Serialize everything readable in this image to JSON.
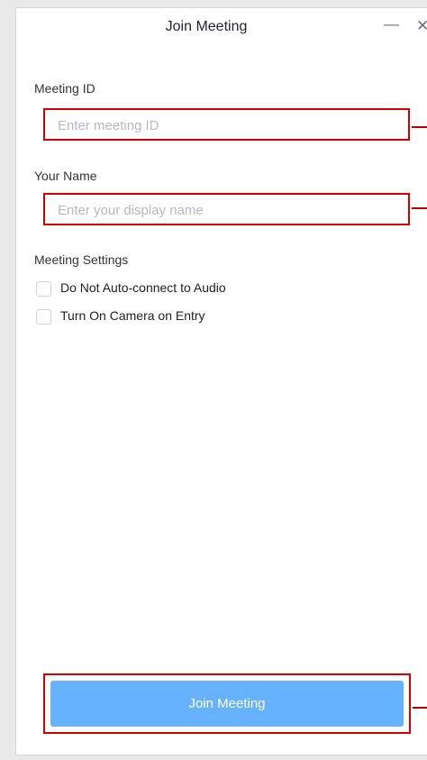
{
  "window": {
    "title": "Join Meeting",
    "minimize_glyph": "—",
    "close_glyph": "✕"
  },
  "meeting_id": {
    "label": "Meeting ID",
    "placeholder": "Enter meeting ID",
    "value": ""
  },
  "your_name": {
    "label": "Your Name",
    "placeholder": "Enter your display name",
    "value": ""
  },
  "settings": {
    "heading": "Meeting Settings",
    "options": [
      {
        "label": "Do Not Auto-connect to Audio",
        "checked": false
      },
      {
        "label": "Turn On Camera on Entry",
        "checked": false
      }
    ]
  },
  "join_button": {
    "label": "Join Meeting"
  },
  "colors": {
    "accent_button": "#66b2ff",
    "highlight_outline": "#d40000"
  }
}
